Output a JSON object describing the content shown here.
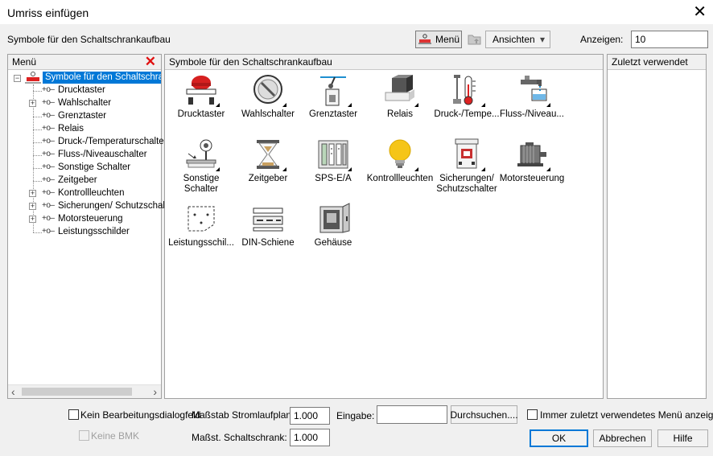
{
  "window": {
    "title": "Umriss einfügen",
    "close_glyph": "✕"
  },
  "section_label": "Symbole für den Schaltschrankaufbau",
  "toolbar": {
    "menu_label": "Menü",
    "views_label": "Ansichten",
    "views_arrow": "▾",
    "show_label": "Anzeigen:",
    "show_value": "10"
  },
  "menu_panel": {
    "header": "Menü",
    "delete_glyph": "✕",
    "root": {
      "label": "Symbole für den Schaltschrankaufbau",
      "toggle": "−"
    },
    "items": [
      {
        "label": "Drucktaster",
        "expandable": false
      },
      {
        "label": "Wahlschalter",
        "expandable": true
      },
      {
        "label": "Grenztaster",
        "expandable": false
      },
      {
        "label": "Relais",
        "expandable": false
      },
      {
        "label": "Druck-/Temperaturschalter",
        "expandable": false
      },
      {
        "label": "Fluss-/Niveauschalter",
        "expandable": false
      },
      {
        "label": "Sonstige Schalter",
        "expandable": false
      },
      {
        "label": "Zeitgeber",
        "expandable": false
      },
      {
        "label": "Kontrollleuchten",
        "expandable": true
      },
      {
        "label": "Sicherungen/ Schutzschalter",
        "expandable": true
      },
      {
        "label": "Motorsteuerung",
        "expandable": true
      },
      {
        "label": "Leistungsschilder",
        "expandable": false
      }
    ],
    "connector_glyph": "+o–",
    "plus_glyph": "+",
    "scroll_left": "‹",
    "scroll_right": "›"
  },
  "symbols_panel": {
    "header": "Symbole für den Schaltschrankaufbau",
    "symbols": [
      {
        "label": "Drucktaster",
        "icon": "push-button-icon"
      },
      {
        "label": "Wahlschalter",
        "icon": "selector-switch-icon"
      },
      {
        "label": "Grenztaster",
        "icon": "limit-switch-icon"
      },
      {
        "label": "Relais",
        "icon": "relay-icon"
      },
      {
        "label": "Druck-/Tempe...",
        "icon": "thermometer-icon"
      },
      {
        "label": "Fluss-/Niveau...",
        "icon": "faucet-icon"
      },
      {
        "label": "Sonstige\nSchalter",
        "icon": "other-switch-icon"
      },
      {
        "label": "Zeitgeber",
        "icon": "hourglass-icon"
      },
      {
        "label": "SPS-E/A",
        "icon": "plc-io-icon"
      },
      {
        "label": "Kontrollleuchten",
        "icon": "light-bulb-icon"
      },
      {
        "label": "Sicherungen/\nSchutzschalter",
        "icon": "fuse-icon"
      },
      {
        "label": "Motorsteuerung",
        "icon": "motor-icon"
      },
      {
        "label": "Leistungsschil...",
        "icon": "nameplate-icon"
      },
      {
        "label": "DIN-Schiene",
        "icon": "din-rail-icon"
      },
      {
        "label": "Gehäuse",
        "icon": "enclosure-icon"
      }
    ]
  },
  "recent_panel": {
    "header": "Zuletzt verwendet"
  },
  "bottom": {
    "no_edit_dialog": "Kein Bearbeitungsdialogfeld",
    "no_bmk": "Keine BMK",
    "scale_schematic_label": "Maßstab Stromlaufplan:",
    "scale_schematic_value": "1.000",
    "scale_cabinet_label": "Maßst. Schaltschrank:",
    "scale_cabinet_value": "1.000",
    "input_label": "Eingabe:",
    "input_value": "",
    "browse_label": "Durchsuchen....",
    "always_recent_label": "Immer zuletzt verwendetes Menü anzeigen",
    "ok_label": "OK",
    "cancel_label": "Abbrechen",
    "help_label": "Hilfe"
  }
}
